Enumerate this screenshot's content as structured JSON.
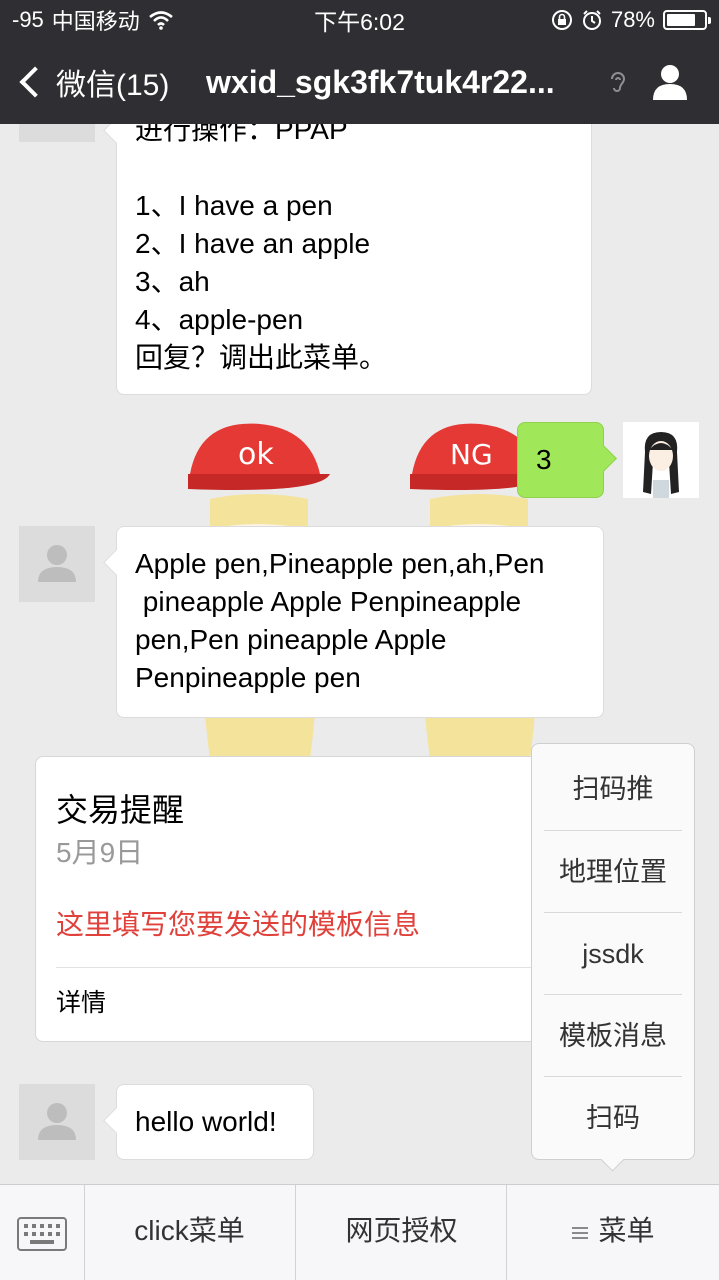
{
  "status_bar": {
    "signal": "-95",
    "carrier": "中国移动",
    "time": "下午6:02",
    "battery": "78%",
    "battery_level": 0.78
  },
  "nav": {
    "back_label": "微信(15)",
    "title": "wxid_sgk3fk7tuk4r22..."
  },
  "messages": {
    "menu_msg": {
      "lines": [
        "进行操作：PPAP",
        "",
        "1、I have a pen",
        "2、I have an apple",
        "3、ah",
        "4、apple-pen",
        "回复？调出此菜单。"
      ]
    },
    "sent_msg": {
      "text": "3"
    },
    "ppap_msg": {
      "lines": [
        "Apple pen,Pineapple pen,ah,Pen",
        " pineapple Apple Penpineapple",
        "pen,Pen pineapple Apple",
        "Penpineapple pen"
      ]
    },
    "template_card": {
      "title": "交易提醒",
      "date": "5月9日",
      "body": "这里填写您要发送的模板信息",
      "detail": "详情"
    },
    "hello_msg": {
      "text": "hello world!"
    }
  },
  "popup_menu": {
    "items": [
      "扫码推",
      "地理位置",
      "jssdk",
      "模板消息",
      "扫码"
    ]
  },
  "bottom_bar": {
    "tabs": [
      "click菜单",
      "网页授权",
      "菜单"
    ]
  },
  "colors": {
    "bar_dark": "#2f2f33",
    "sent_bubble": "#a0e75a",
    "template_red": "#e0413b",
    "background": "#ebebeb"
  },
  "icons": [
    "wifi-icon",
    "lock-rotation-icon",
    "alarm-icon",
    "battery-icon",
    "back-chevron-icon",
    "ear-icon",
    "person-icon",
    "keyboard-icon",
    "menu-lines-icon"
  ]
}
